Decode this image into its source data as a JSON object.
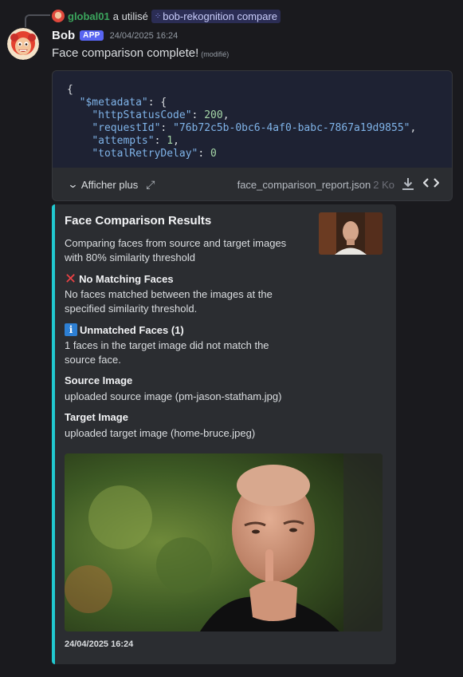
{
  "reply": {
    "user": "global01",
    "verb": "a utilisé",
    "command": "bob-rekognition compare"
  },
  "message": {
    "author": "Bob",
    "app_tag": "APP",
    "timestamp": "24/04/2025 16:24",
    "content": "Face comparison complete!",
    "edited": "(modifié)"
  },
  "attachment": {
    "code_lines": {
      "l1": "{",
      "l2_key": "\"$metadata\"",
      "l2_rest": ": {",
      "l3_key": "\"httpStatusCode\"",
      "l3_val": "200",
      "l4_key": "\"requestId\"",
      "l4_val": "\"76b72c5b-0bc6-4af0-babc-7867a19d9855\"",
      "l5_key": "\"attempts\"",
      "l5_val": "1",
      "l6_key": "\"totalRetryDelay\"",
      "l6_val": "0"
    },
    "show_more_label": "Afficher plus",
    "file_name": "face_comparison_report.json",
    "file_size": "2 Ko"
  },
  "embed": {
    "accent_color": "#21c9d0",
    "title": "Face Comparison Results",
    "description": "Comparing faces from source and target images with 80% similarity threshold",
    "fields": [
      {
        "title": "No Matching Faces",
        "value": "No faces matched between the images at the specified similarity threshold."
      },
      {
        "title": "Unmatched Faces (1)",
        "value": "1 faces in the target image did not match the source face."
      },
      {
        "title": "Source Image",
        "value": "uploaded source image (pm-jason-statham.jpg)"
      },
      {
        "title": "Target Image",
        "value": "uploaded target image (home-bruce.jpeg)"
      }
    ],
    "footer_timestamp": "24/04/2025 16:24"
  }
}
